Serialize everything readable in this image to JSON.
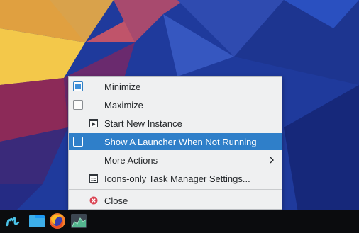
{
  "menu": {
    "items": [
      {
        "label": "Minimize",
        "control": "checkbox",
        "checked": true,
        "icon": null,
        "submenu": false,
        "highlighted": false
      },
      {
        "label": "Maximize",
        "control": "checkbox",
        "checked": false,
        "icon": null,
        "submenu": false,
        "highlighted": false
      },
      {
        "label": "Start New Instance",
        "control": "icon",
        "checked": null,
        "icon": "start-instance-icon",
        "submenu": false,
        "highlighted": false
      },
      {
        "label": "Show A Launcher When Not Running",
        "control": "checkbox",
        "checked": false,
        "icon": null,
        "submenu": false,
        "highlighted": true
      },
      {
        "label": "More Actions",
        "control": "none",
        "checked": null,
        "icon": null,
        "submenu": true,
        "highlighted": false
      },
      {
        "label": "Icons-only Task Manager Settings...",
        "control": "icon",
        "checked": null,
        "icon": "settings-list-icon",
        "submenu": false,
        "highlighted": false
      },
      {
        "label": "Close",
        "control": "icon",
        "checked": null,
        "icon": "close-icon",
        "submenu": false,
        "highlighted": false
      }
    ]
  },
  "taskbar": {
    "icons": [
      "app-launcher-icon",
      "file-manager-icon",
      "firefox-icon",
      "system-monitor-icon"
    ]
  },
  "colors": {
    "highlight": "#2f7fc9",
    "menu_background": "#eff0f1",
    "taskbar": "#0b0c0e",
    "close_red": "#da4453"
  }
}
